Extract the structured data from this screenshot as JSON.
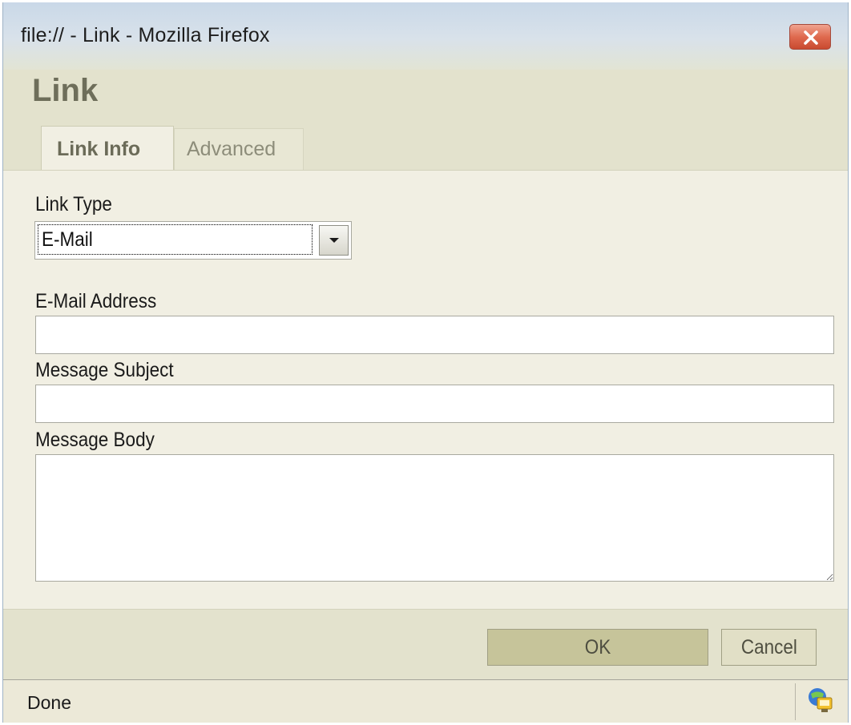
{
  "window": {
    "title": "file:// - Link - Mozilla Firefox"
  },
  "dialog": {
    "title": "Link",
    "tabs": [
      {
        "label": "Link Info",
        "active": true
      },
      {
        "label": "Advanced",
        "active": false
      }
    ]
  },
  "form": {
    "link_type_label": "Link Type",
    "link_type_value": "E-Mail",
    "email_address_label": "E-Mail Address",
    "email_address_value": "",
    "message_subject_label": "Message Subject",
    "message_subject_value": "",
    "message_body_label": "Message Body",
    "message_body_value": ""
  },
  "buttons": {
    "ok_label": "OK",
    "cancel_label": "Cancel"
  },
  "status": {
    "text": "Done",
    "icon": "network-status-icon"
  },
  "colors": {
    "accent_header": "#e3e2cd",
    "ok_button": "#c6c49a",
    "close_button": "#df6a4f"
  }
}
